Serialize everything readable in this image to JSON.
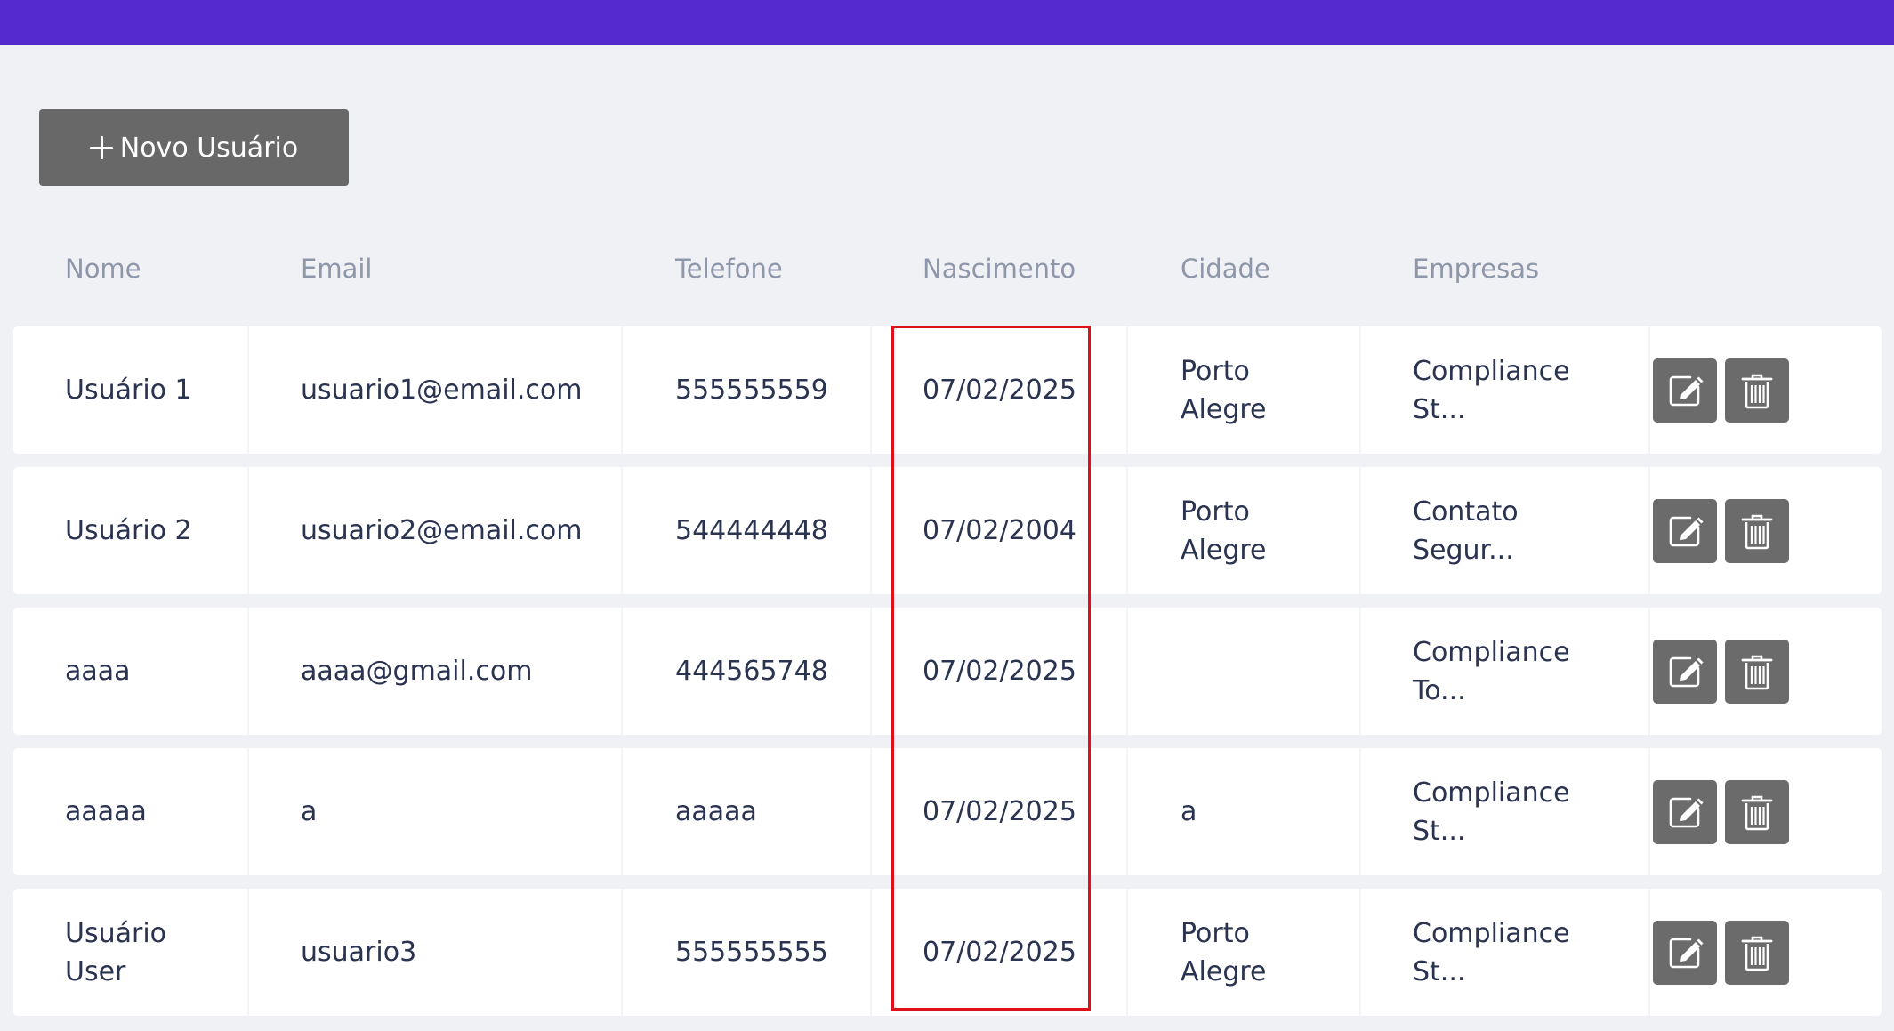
{
  "toolbar": {
    "new_user_label": "Novo Usuário"
  },
  "table": {
    "headers": [
      "Nome",
      "Email",
      "Telefone",
      "Nascimento",
      "Cidade",
      "Empresas"
    ],
    "rows": [
      {
        "nome": "Usuário 1",
        "email": "usuario1@email.com",
        "telefone": "555555559",
        "nascimento": "07/02/2025",
        "cidade_line1": "Porto",
        "cidade_line2": "Alegre",
        "empresa_line1": "Compliance",
        "empresa_line2": "St..."
      },
      {
        "nome": "Usuário 2",
        "email": "usuario2@email.com",
        "telefone": "544444448",
        "nascimento": "07/02/2004",
        "cidade_line1": "Porto",
        "cidade_line2": "Alegre",
        "empresa_line1": "Contato",
        "empresa_line2": "Segur..."
      },
      {
        "nome": "aaaa",
        "email": "aaaa@gmail.com",
        "telefone": "444565748",
        "nascimento": "07/02/2025",
        "cidade_line1": "",
        "cidade_line2": "",
        "empresa_line1": "Compliance",
        "empresa_line2": "To..."
      },
      {
        "nome": "aaaaa",
        "email": "a",
        "telefone": "aaaaa",
        "nascimento": "07/02/2025",
        "cidade_line1": "a",
        "cidade_line2": "",
        "empresa_line1": "Compliance",
        "empresa_line2": "St..."
      },
      {
        "nome_line1": "Usuário",
        "nome_line2": "User",
        "email": "usuario3",
        "telefone": "555555555",
        "nascimento": "07/02/2025",
        "cidade_line1": "Porto",
        "cidade_line2": "Alegre",
        "empresa_line1": "Compliance",
        "empresa_line2": "St..."
      }
    ]
  },
  "icons": {
    "new": "plus-icon",
    "edit": "edit-icon",
    "delete": "trash-icon"
  },
  "colors": {
    "topbar": "#552bd0",
    "button": "#686868",
    "highlight": "#e0101a",
    "header_text": "#8e96aa",
    "cell_text": "#2a3350"
  }
}
